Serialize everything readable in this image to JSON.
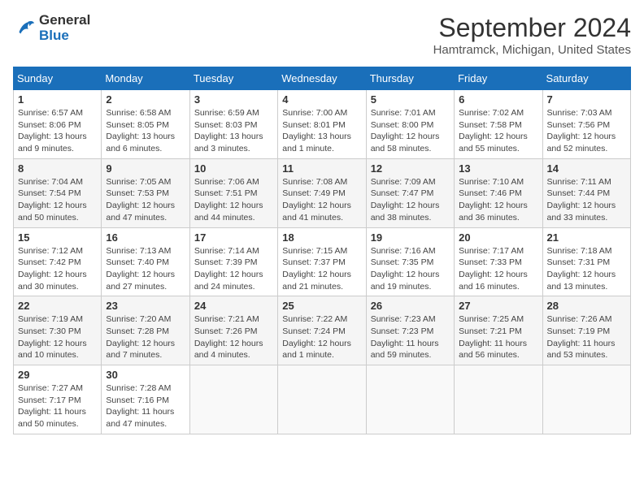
{
  "header": {
    "logo_line1": "General",
    "logo_line2": "Blue",
    "title": "September 2024",
    "subtitle": "Hamtramck, Michigan, United States"
  },
  "calendar": {
    "weekdays": [
      "Sunday",
      "Monday",
      "Tuesday",
      "Wednesday",
      "Thursday",
      "Friday",
      "Saturday"
    ],
    "weeks": [
      [
        {
          "day": "1",
          "info": "Sunrise: 6:57 AM\nSunset: 8:06 PM\nDaylight: 13 hours\nand 9 minutes."
        },
        {
          "day": "2",
          "info": "Sunrise: 6:58 AM\nSunset: 8:05 PM\nDaylight: 13 hours\nand 6 minutes."
        },
        {
          "day": "3",
          "info": "Sunrise: 6:59 AM\nSunset: 8:03 PM\nDaylight: 13 hours\nand 3 minutes."
        },
        {
          "day": "4",
          "info": "Sunrise: 7:00 AM\nSunset: 8:01 PM\nDaylight: 13 hours\nand 1 minute."
        },
        {
          "day": "5",
          "info": "Sunrise: 7:01 AM\nSunset: 8:00 PM\nDaylight: 12 hours\nand 58 minutes."
        },
        {
          "day": "6",
          "info": "Sunrise: 7:02 AM\nSunset: 7:58 PM\nDaylight: 12 hours\nand 55 minutes."
        },
        {
          "day": "7",
          "info": "Sunrise: 7:03 AM\nSunset: 7:56 PM\nDaylight: 12 hours\nand 52 minutes."
        }
      ],
      [
        {
          "day": "8",
          "info": "Sunrise: 7:04 AM\nSunset: 7:54 PM\nDaylight: 12 hours\nand 50 minutes."
        },
        {
          "day": "9",
          "info": "Sunrise: 7:05 AM\nSunset: 7:53 PM\nDaylight: 12 hours\nand 47 minutes."
        },
        {
          "day": "10",
          "info": "Sunrise: 7:06 AM\nSunset: 7:51 PM\nDaylight: 12 hours\nand 44 minutes."
        },
        {
          "day": "11",
          "info": "Sunrise: 7:08 AM\nSunset: 7:49 PM\nDaylight: 12 hours\nand 41 minutes."
        },
        {
          "day": "12",
          "info": "Sunrise: 7:09 AM\nSunset: 7:47 PM\nDaylight: 12 hours\nand 38 minutes."
        },
        {
          "day": "13",
          "info": "Sunrise: 7:10 AM\nSunset: 7:46 PM\nDaylight: 12 hours\nand 36 minutes."
        },
        {
          "day": "14",
          "info": "Sunrise: 7:11 AM\nSunset: 7:44 PM\nDaylight: 12 hours\nand 33 minutes."
        }
      ],
      [
        {
          "day": "15",
          "info": "Sunrise: 7:12 AM\nSunset: 7:42 PM\nDaylight: 12 hours\nand 30 minutes."
        },
        {
          "day": "16",
          "info": "Sunrise: 7:13 AM\nSunset: 7:40 PM\nDaylight: 12 hours\nand 27 minutes."
        },
        {
          "day": "17",
          "info": "Sunrise: 7:14 AM\nSunset: 7:39 PM\nDaylight: 12 hours\nand 24 minutes."
        },
        {
          "day": "18",
          "info": "Sunrise: 7:15 AM\nSunset: 7:37 PM\nDaylight: 12 hours\nand 21 minutes."
        },
        {
          "day": "19",
          "info": "Sunrise: 7:16 AM\nSunset: 7:35 PM\nDaylight: 12 hours\nand 19 minutes."
        },
        {
          "day": "20",
          "info": "Sunrise: 7:17 AM\nSunset: 7:33 PM\nDaylight: 12 hours\nand 16 minutes."
        },
        {
          "day": "21",
          "info": "Sunrise: 7:18 AM\nSunset: 7:31 PM\nDaylight: 12 hours\nand 13 minutes."
        }
      ],
      [
        {
          "day": "22",
          "info": "Sunrise: 7:19 AM\nSunset: 7:30 PM\nDaylight: 12 hours\nand 10 minutes."
        },
        {
          "day": "23",
          "info": "Sunrise: 7:20 AM\nSunset: 7:28 PM\nDaylight: 12 hours\nand 7 minutes."
        },
        {
          "day": "24",
          "info": "Sunrise: 7:21 AM\nSunset: 7:26 PM\nDaylight: 12 hours\nand 4 minutes."
        },
        {
          "day": "25",
          "info": "Sunrise: 7:22 AM\nSunset: 7:24 PM\nDaylight: 12 hours\nand 1 minute."
        },
        {
          "day": "26",
          "info": "Sunrise: 7:23 AM\nSunset: 7:23 PM\nDaylight: 11 hours\nand 59 minutes."
        },
        {
          "day": "27",
          "info": "Sunrise: 7:25 AM\nSunset: 7:21 PM\nDaylight: 11 hours\nand 56 minutes."
        },
        {
          "day": "28",
          "info": "Sunrise: 7:26 AM\nSunset: 7:19 PM\nDaylight: 11 hours\nand 53 minutes."
        }
      ],
      [
        {
          "day": "29",
          "info": "Sunrise: 7:27 AM\nSunset: 7:17 PM\nDaylight: 11 hours\nand 50 minutes."
        },
        {
          "day": "30",
          "info": "Sunrise: 7:28 AM\nSunset: 7:16 PM\nDaylight: 11 hours\nand 47 minutes."
        },
        null,
        null,
        null,
        null,
        null
      ]
    ]
  }
}
